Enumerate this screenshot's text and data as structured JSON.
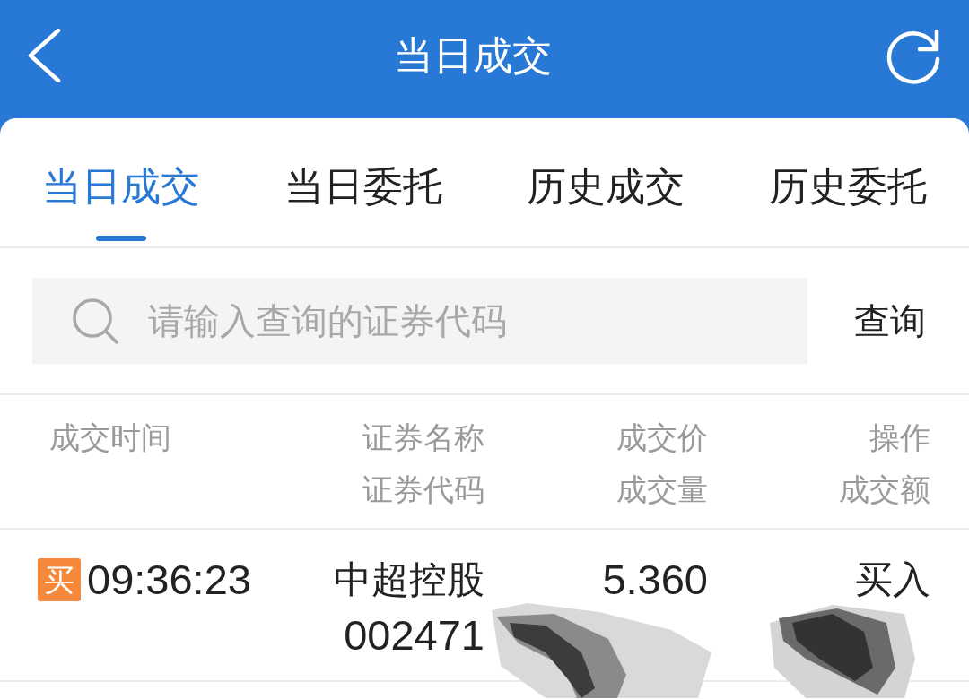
{
  "header": {
    "title": "当日成交"
  },
  "tabs": [
    {
      "label": "当日成交",
      "selected": true
    },
    {
      "label": "当日委托",
      "selected": false
    },
    {
      "label": "历史成交",
      "selected": false
    },
    {
      "label": "历史委托",
      "selected": false
    }
  ],
  "search": {
    "placeholder": "请输入查询的证券代码",
    "button": "查询"
  },
  "table": {
    "columns": [
      {
        "line_1": "成交时间"
      },
      {
        "line_1": "证券名称",
        "line_2": "证券代码"
      },
      {
        "line_1": "成交价",
        "line_2": "成交量"
      },
      {
        "line_1": "操作",
        "line_2": "成交额"
      }
    ],
    "rows": [
      {
        "side_tag": "买",
        "time": "09:36:23",
        "name": "中超控股",
        "code": "002471",
        "price": "5.360",
        "action": "买入"
      }
    ]
  }
}
